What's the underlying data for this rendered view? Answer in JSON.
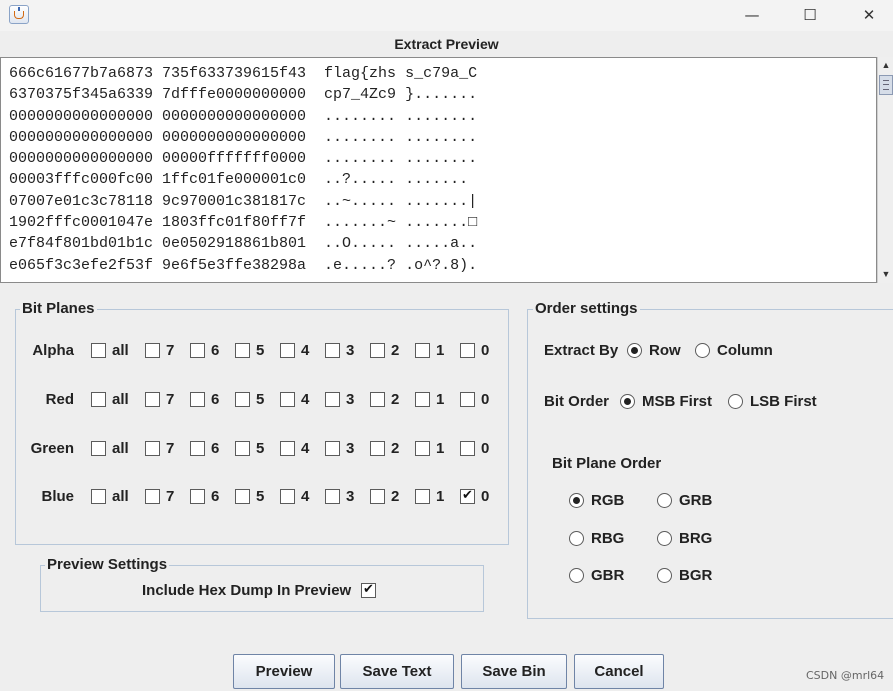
{
  "window": {
    "minimize": "—",
    "maximize": "☐",
    "close": "✕"
  },
  "preview": {
    "title": "Extract Preview",
    "content": "666c61677b7a6873 735f633739615f43  flag{zhs s_c79a_C\n6370375f345a6339 7dfffe0000000000  cp7_4Zc9 }.......\n0000000000000000 0000000000000000  ........ ........\n0000000000000000 0000000000000000  ........ ........\n0000000000000000 00000fffffff0000  ........ ........\n00003fffc000fc00 1ffc01fe000001c0  ..?..... .......\n07007e01c3c78118 9c970001c381817c  ..~..... .......|\n1902fffc0001047e 1803ffc01f80ff7f  .......~ .......□\ne7f84f801bd01b1c 0e0502918861b801  ..O..... .....a..\ne065f3c3efe2f53f 9e6f5e3ffe38298a  .e.....? .o^?.8).",
    "scroll_up": "▲",
    "scroll_down": "▼"
  },
  "bit_planes": {
    "title": "Bit Planes",
    "rows": [
      {
        "name": "Alpha",
        "checked": []
      },
      {
        "name": "Red",
        "checked": []
      },
      {
        "name": "Green",
        "checked": []
      },
      {
        "name": "Blue",
        "checked": [
          "0"
        ]
      }
    ],
    "options": [
      "all",
      "7",
      "6",
      "5",
      "4",
      "3",
      "2",
      "1",
      "0"
    ]
  },
  "preview_settings": {
    "title": "Preview Settings",
    "include_hex_label": "Include Hex Dump In Preview",
    "include_hex_checked": true
  },
  "order_settings": {
    "title": "Order settings",
    "extract_by_label": "Extract By",
    "extract_by_options": [
      "Row",
      "Column"
    ],
    "extract_by_selected": "Row",
    "bit_order_label": "Bit Order",
    "bit_order_options": [
      "MSB First",
      "LSB First"
    ],
    "bit_order_selected": "MSB First",
    "bit_plane_order_label": "Bit Plane Order",
    "bit_plane_order_options": [
      "RGB",
      "GRB",
      "RBG",
      "BRG",
      "GBR",
      "BGR"
    ],
    "bit_plane_order_selected": "RGB"
  },
  "buttons": {
    "preview": "Preview",
    "save_text": "Save Text",
    "save_bin": "Save Bin",
    "cancel": "Cancel"
  },
  "watermark": "CSDN @mrl64"
}
